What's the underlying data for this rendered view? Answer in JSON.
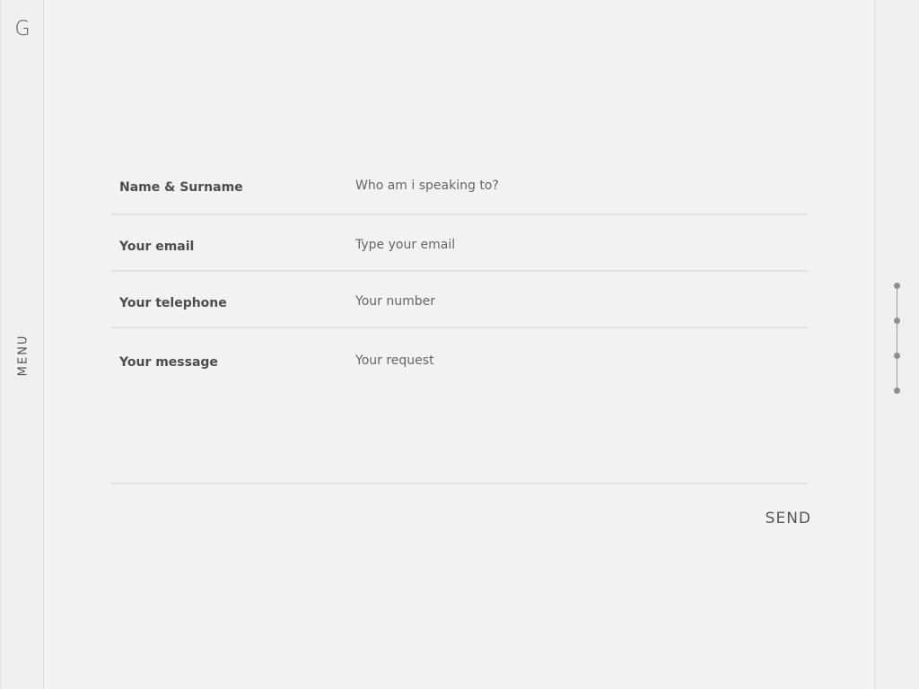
{
  "sidebar": {
    "logo": "G",
    "menu_label": "MENU"
  },
  "form": {
    "fields": [
      {
        "label": "Name & Surname",
        "placeholder": "Who am i speaking to?"
      },
      {
        "label": "Your email",
        "placeholder": "Type your email"
      },
      {
        "label": "Your telephone",
        "placeholder": "Your number"
      },
      {
        "label": "Your message",
        "placeholder": "Your request"
      }
    ],
    "send_label": "SEND"
  },
  "pager": {
    "dot_count": 4,
    "active_index": 0
  },
  "colors": {
    "background": "#f2f2f2",
    "text": "#4a4a4a",
    "divider": "#e3e3e3",
    "dot": "#8e8e8e"
  }
}
